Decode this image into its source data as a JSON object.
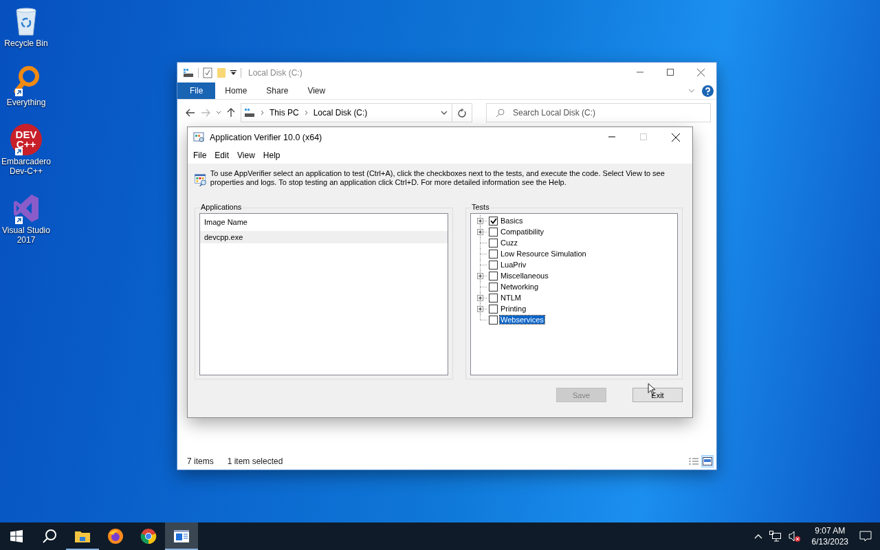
{
  "desktop_icons": [
    {
      "label": "Recycle Bin",
      "kind": "recycle",
      "shortcut": false
    },
    {
      "label": "Everything",
      "kind": "magnifier",
      "shortcut": true
    },
    {
      "label": "Embarcadero Dev-C++",
      "kind": "devcpp",
      "shortcut": true,
      "logo_text": [
        "DEV",
        "C++"
      ]
    },
    {
      "label": "Visual Studio 2017",
      "kind": "vs",
      "shortcut": true
    }
  ],
  "explorer": {
    "title": "Local Disk (C:)",
    "ribbon_tabs": [
      {
        "label": "File",
        "kind": "menu"
      },
      {
        "label": "Home",
        "kind": "tab"
      },
      {
        "label": "Share",
        "kind": "tab"
      },
      {
        "label": "View",
        "kind": "tab"
      }
    ],
    "address": [
      "This PC",
      "Local Disk (C:)"
    ],
    "search": {
      "placeholder": "Search Local Disk (C:)"
    },
    "status_bar": [
      "7 items",
      "1 item selected"
    ],
    "view_buttons": [
      {
        "kind": "details",
        "selected": false
      },
      {
        "kind": "large",
        "selected": true
      }
    ]
  },
  "verifier": {
    "title": "Application Verifier 10.0 (x64)",
    "menu": [
      "File",
      "Edit",
      "View",
      "Help"
    ],
    "info": "To use AppVerifier select an application to test (Ctrl+A), click the checkboxes next to the tests, and execute the code. Select View to see properties and logs. To stop testing an application click Ctrl+D. For more detailed information see the Help.",
    "applications": {
      "label": "Applications",
      "column": "Image Name",
      "rows": [
        {
          "name": "devcpp.exe",
          "selected": true
        }
      ]
    },
    "tests": {
      "label": "Tests",
      "items": [
        {
          "label": "Basics",
          "checked": true,
          "expandable": true,
          "selected": false
        },
        {
          "label": "Compatibility",
          "checked": false,
          "expandable": true,
          "selected": false
        },
        {
          "label": "Cuzz",
          "checked": false,
          "expandable": false,
          "selected": false
        },
        {
          "label": "Low Resource Simulation",
          "checked": false,
          "expandable": false,
          "selected": false
        },
        {
          "label": "LuaPriv",
          "checked": false,
          "expandable": false,
          "selected": false
        },
        {
          "label": "Miscellaneous",
          "checked": false,
          "expandable": true,
          "selected": false
        },
        {
          "label": "Networking",
          "checked": false,
          "expandable": false,
          "selected": false
        },
        {
          "label": "NTLM",
          "checked": false,
          "expandable": true,
          "selected": false
        },
        {
          "label": "Printing",
          "checked": false,
          "expandable": true,
          "selected": false
        },
        {
          "label": "Webservices",
          "checked": false,
          "expandable": false,
          "selected": true
        }
      ]
    },
    "buttons": [
      {
        "label": "Save",
        "disabled": true
      },
      {
        "label": "Exit",
        "disabled": false
      }
    ]
  },
  "taskbar": {
    "apps": [
      {
        "kind": "start",
        "running": false,
        "active": false
      },
      {
        "kind": "search",
        "running": false,
        "active": false
      },
      {
        "kind": "explorer",
        "running": true,
        "active": false
      },
      {
        "kind": "firefox",
        "running": false,
        "active": false
      },
      {
        "kind": "chrome",
        "running": false,
        "active": false
      },
      {
        "kind": "appverifier",
        "running": true,
        "active": true
      }
    ],
    "volume_muted": true,
    "time": "9:07 AM",
    "date": "6/13/2023"
  }
}
